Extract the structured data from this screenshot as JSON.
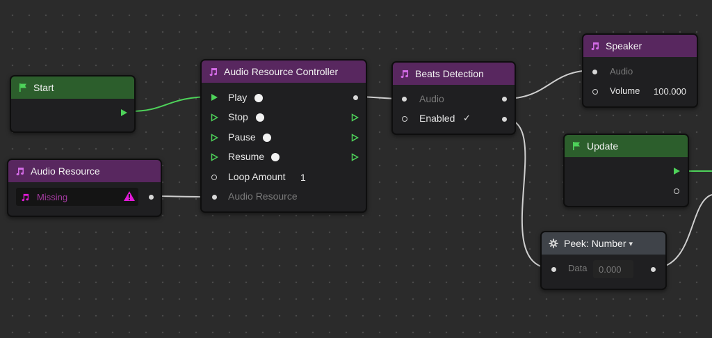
{
  "nodes": {
    "start": {
      "title": "Start"
    },
    "audio_resource": {
      "title": "Audio Resource",
      "field_value": "Missing"
    },
    "controller": {
      "title": "Audio Resource Controller",
      "inputs": [
        "Play",
        "Stop",
        "Pause",
        "Resume",
        "Loop Amount",
        "Audio Resource"
      ],
      "loop_amount_value": "1"
    },
    "beats": {
      "title": "Beats Detection",
      "inputs": [
        "Audio",
        "Enabled"
      ],
      "enabled_check": "✓"
    },
    "speaker": {
      "title": "Speaker",
      "inputs": [
        "Audio",
        "Volume"
      ],
      "volume_value": "100.000"
    },
    "update": {
      "title": "Update"
    },
    "peek": {
      "title": "Peek: Number",
      "dropdown_glyph": "▾",
      "inputs": [
        "Data"
      ],
      "data_value": "0.000"
    }
  },
  "colors": {
    "flow_green": "#4ed35a",
    "header_green": "#2c5e2c",
    "header_purple": "#58275f",
    "header_gray": "#3f4349",
    "warning_magenta": "#e21ad8",
    "wire_gray": "#cfcfcf"
  },
  "icons": {
    "event_header": "flag-icon",
    "audio_header": "music-note-icon",
    "peek_header": "gear-icon",
    "missing_warning": "warning-triangle-icon"
  }
}
